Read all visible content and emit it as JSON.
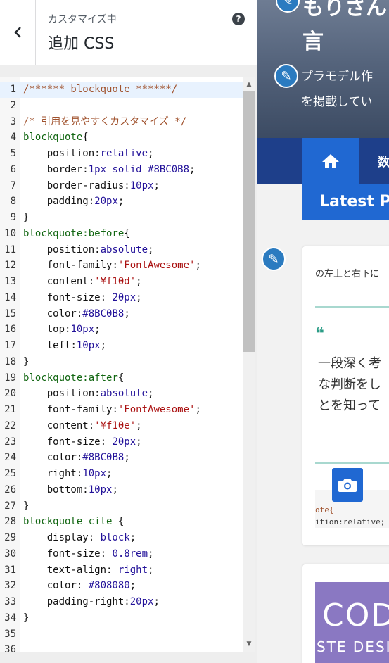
{
  "header": {
    "subtitle": "カスタマイズ中",
    "title": "追加 CSS",
    "help": "?"
  },
  "editor": {
    "lines": [
      {
        "n": "1",
        "parts": [
          [
            "c-comment",
            "/****** blockquote ******/"
          ]
        ]
      },
      {
        "n": "2",
        "parts": []
      },
      {
        "n": "3",
        "parts": [
          [
            "c-comment",
            "/* 引用を見やすくカスタマイズ */"
          ]
        ]
      },
      {
        "n": "4",
        "parts": [
          [
            "c-sel",
            "blockquote"
          ],
          [
            "c-prop",
            "{"
          ]
        ]
      },
      {
        "n": "5",
        "parts": [
          [
            "c-prop",
            "    position"
          ],
          [
            "c-prop",
            ":"
          ],
          [
            "c-val",
            "relative"
          ],
          [
            "c-prop",
            ";"
          ]
        ]
      },
      {
        "n": "6",
        "parts": [
          [
            "c-prop",
            "    border"
          ],
          [
            "c-prop",
            ":"
          ],
          [
            "c-val",
            "1px solid #8BC0B8"
          ],
          [
            "c-prop",
            ";"
          ]
        ]
      },
      {
        "n": "7",
        "parts": [
          [
            "c-prop",
            "    border-radius"
          ],
          [
            "c-prop",
            ":"
          ],
          [
            "c-val",
            "10px"
          ],
          [
            "c-prop",
            ";"
          ]
        ]
      },
      {
        "n": "8",
        "parts": [
          [
            "c-prop",
            "    padding"
          ],
          [
            "c-prop",
            ":"
          ],
          [
            "c-val",
            "20px"
          ],
          [
            "c-prop",
            ";"
          ]
        ]
      },
      {
        "n": "9",
        "parts": [
          [
            "c-prop",
            "}"
          ]
        ]
      },
      {
        "n": "10",
        "parts": [
          [
            "c-sel",
            "blockquote:before"
          ],
          [
            "c-prop",
            "{"
          ]
        ]
      },
      {
        "n": "11",
        "parts": [
          [
            "c-prop",
            "    position"
          ],
          [
            "c-prop",
            ":"
          ],
          [
            "c-val",
            "absolute"
          ],
          [
            "c-prop",
            ";"
          ]
        ]
      },
      {
        "n": "12",
        "parts": [
          [
            "c-prop",
            "    font-family"
          ],
          [
            "c-prop",
            ":"
          ],
          [
            "c-str",
            "'FontAwesome'"
          ],
          [
            "c-prop",
            ";"
          ]
        ]
      },
      {
        "n": "13",
        "parts": [
          [
            "c-prop",
            "    content"
          ],
          [
            "c-prop",
            ":"
          ],
          [
            "c-str",
            "'¥f10d'"
          ],
          [
            "c-prop",
            ";"
          ]
        ]
      },
      {
        "n": "14",
        "parts": [
          [
            "c-prop",
            "    font-size"
          ],
          [
            "c-prop",
            ": "
          ],
          [
            "c-val",
            "20px"
          ],
          [
            "c-prop",
            ";"
          ]
        ]
      },
      {
        "n": "15",
        "parts": [
          [
            "c-prop",
            "    color"
          ],
          [
            "c-prop",
            ":"
          ],
          [
            "c-val",
            "#8BC0B8"
          ],
          [
            "c-prop",
            ";"
          ]
        ]
      },
      {
        "n": "16",
        "parts": [
          [
            "c-prop",
            "    top"
          ],
          [
            "c-prop",
            ":"
          ],
          [
            "c-val",
            "10px"
          ],
          [
            "c-prop",
            ";"
          ]
        ]
      },
      {
        "n": "17",
        "parts": [
          [
            "c-prop",
            "    left"
          ],
          [
            "c-prop",
            ":"
          ],
          [
            "c-val",
            "10px"
          ],
          [
            "c-prop",
            ";"
          ]
        ]
      },
      {
        "n": "18",
        "parts": [
          [
            "c-prop",
            "}"
          ]
        ]
      },
      {
        "n": "19",
        "parts": [
          [
            "c-sel",
            "blockquote:after"
          ],
          [
            "c-prop",
            "{"
          ]
        ]
      },
      {
        "n": "20",
        "parts": [
          [
            "c-prop",
            "    position"
          ],
          [
            "c-prop",
            ":"
          ],
          [
            "c-val",
            "absolute"
          ],
          [
            "c-prop",
            ";"
          ]
        ]
      },
      {
        "n": "21",
        "parts": [
          [
            "c-prop",
            "    font-family"
          ],
          [
            "c-prop",
            ":"
          ],
          [
            "c-str",
            "'FontAwesome'"
          ],
          [
            "c-prop",
            ";"
          ]
        ]
      },
      {
        "n": "22",
        "parts": [
          [
            "c-prop",
            "    content"
          ],
          [
            "c-prop",
            ":"
          ],
          [
            "c-str",
            "'¥f10e'"
          ],
          [
            "c-prop",
            ";"
          ]
        ]
      },
      {
        "n": "23",
        "parts": [
          [
            "c-prop",
            "    font-size"
          ],
          [
            "c-prop",
            ": "
          ],
          [
            "c-val",
            "20px"
          ],
          [
            "c-prop",
            ";"
          ]
        ]
      },
      {
        "n": "24",
        "parts": [
          [
            "c-prop",
            "    color"
          ],
          [
            "c-prop",
            ":"
          ],
          [
            "c-val",
            "#8BC0B8"
          ],
          [
            "c-prop",
            ";"
          ]
        ]
      },
      {
        "n": "25",
        "parts": [
          [
            "c-prop",
            "    right"
          ],
          [
            "c-prop",
            ":"
          ],
          [
            "c-val",
            "10px"
          ],
          [
            "c-prop",
            ";"
          ]
        ]
      },
      {
        "n": "26",
        "parts": [
          [
            "c-prop",
            "    bottom"
          ],
          [
            "c-prop",
            ":"
          ],
          [
            "c-val",
            "10px"
          ],
          [
            "c-prop",
            ";"
          ]
        ]
      },
      {
        "n": "27",
        "parts": [
          [
            "c-prop",
            "}"
          ]
        ]
      },
      {
        "n": "28",
        "parts": [
          [
            "c-sel",
            "blockquote cite "
          ],
          [
            "c-prop",
            "{"
          ]
        ]
      },
      {
        "n": "29",
        "parts": [
          [
            "c-prop",
            "    display"
          ],
          [
            "c-prop",
            ": "
          ],
          [
            "c-val",
            "block"
          ],
          [
            "c-prop",
            ";"
          ]
        ]
      },
      {
        "n": "30",
        "parts": [
          [
            "c-prop",
            "    font-size"
          ],
          [
            "c-prop",
            ": "
          ],
          [
            "c-val",
            "0.8rem"
          ],
          [
            "c-prop",
            ";"
          ]
        ]
      },
      {
        "n": "31",
        "parts": [
          [
            "c-prop",
            "    text-align"
          ],
          [
            "c-prop",
            ": "
          ],
          [
            "c-val",
            "right"
          ],
          [
            "c-prop",
            ";"
          ]
        ]
      },
      {
        "n": "32",
        "parts": [
          [
            "c-prop",
            "    color"
          ],
          [
            "c-prop",
            ": "
          ],
          [
            "c-val",
            "#808080"
          ],
          [
            "c-prop",
            ";"
          ]
        ]
      },
      {
        "n": "33",
        "parts": [
          [
            "c-prop",
            "    padding-right"
          ],
          [
            "c-prop",
            ":"
          ],
          [
            "c-val",
            "20px"
          ],
          [
            "c-prop",
            ";"
          ]
        ]
      },
      {
        "n": "34",
        "parts": [
          [
            "c-prop",
            "}"
          ]
        ]
      },
      {
        "n": "35",
        "parts": []
      },
      {
        "n": "36",
        "parts": []
      }
    ]
  },
  "preview": {
    "hero_title_top": "もりさん",
    "hero_title_line2": "言",
    "hero_line3": "プラモデル作",
    "hero_line4": "を掲載してい",
    "nav_item": "数",
    "latest": "Latest Po",
    "card_text": "の左上と右下に",
    "quote_mark": "❝",
    "quote_lines": [
      "一段深く考",
      "な判断をし",
      "とを知って"
    ],
    "code_line1": "ote{",
    "code_line2": "ition:relative;",
    "thumb_big": "CODE",
    "thumb_small": "STE DESIGN"
  },
  "colors": {
    "accent": "#2068d2",
    "nav": "#1e3f8a",
    "teal": "#8BC0B8"
  }
}
